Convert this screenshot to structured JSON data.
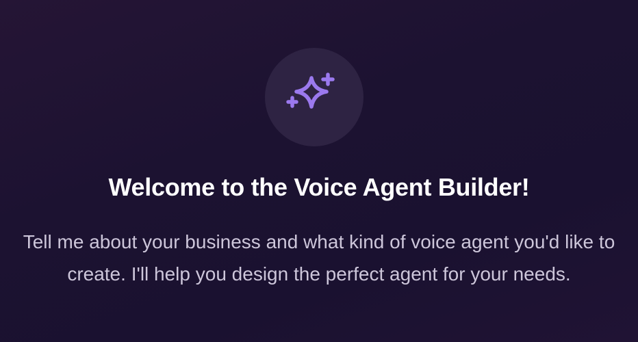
{
  "welcome": {
    "icon": "sparkles-icon",
    "accent_color": "#9b79ee",
    "title": "Welcome to the Voice Agent Builder!",
    "description": "Tell me about your business and what kind of voice agent you'd like to create. I'll help you design the perfect agent for your needs."
  }
}
